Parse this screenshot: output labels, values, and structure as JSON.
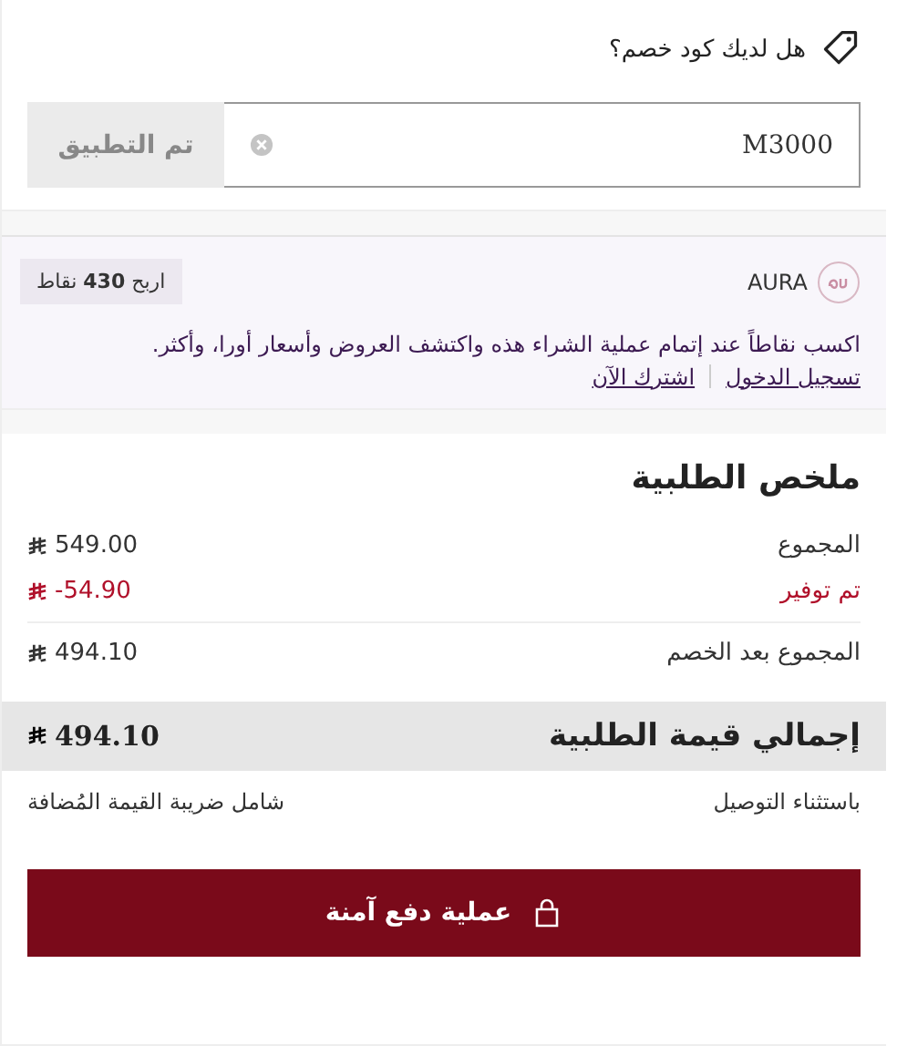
{
  "coupon": {
    "question": "هل لديك كود خصم؟",
    "value": "M3000",
    "apply_button": {
      "label": "تم التطبيق",
      "disabled": true
    }
  },
  "loyalty": {
    "brand": "AURA",
    "points": "اربح **430** نقاط",
    "description": "اكسب نقاطاً عند إتمام عملية الشراء هذه واكتشف العروض وأسعار أورا، وأكثر.",
    "links": [
      "تسجيل الدخول",
      "اشترك الآن"
    ]
  },
  "summary": {
    "title": "ملخص الطلبية",
    "rows": [
      {
        "label": "المجموع",
        "amount": "549.00",
        "kind": "normal"
      },
      {
        "label": "تم توفير",
        "amount": "-54.90",
        "kind": "discount"
      },
      {
        "label": "المجموع بعد الخصم",
        "amount": "494.10",
        "kind": "normal"
      }
    ],
    "total": {
      "label": "إجمالي قيمة الطلبية",
      "amount": "494.10"
    },
    "notes": [
      "باستثناء التوصيل",
      "شامل ضريبة القيمة المُضافة"
    ],
    "checkout_button": "عملية دفع آمنة"
  }
}
